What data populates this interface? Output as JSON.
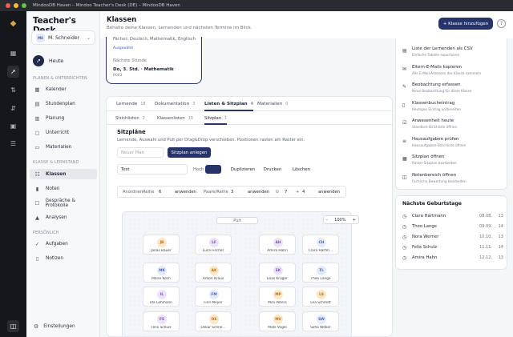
{
  "window": {
    "title": "MindooDB Haven – Mindoo Teacher's Desk (DE) – MindooDB Haven",
    "colors": {
      "close": "#ee5f58",
      "min": "#f6bd3b",
      "max": "#5ec648"
    }
  },
  "rail": {
    "icons": [
      "app-logo-icon",
      "dashboard-icon",
      "rocket-icon",
      "transfer-icon",
      "sort-icon",
      "image-icon",
      "sliders-icon",
      "sidebar-toggle-icon"
    ]
  },
  "sidebar": {
    "logo": "Teacher's Desk",
    "user": {
      "initials": "MS",
      "name": "M. Schneider"
    },
    "home": "Heute",
    "sec1": "PLANEN & UNTERRICHTEN",
    "nav1": [
      {
        "label": "Kalender",
        "icon": "▦"
      },
      {
        "label": "Stundenplan",
        "icon": "▤"
      },
      {
        "label": "Planung",
        "icon": "▥"
      },
      {
        "label": "Unterricht",
        "icon": "▢"
      },
      {
        "label": "Materialien",
        "icon": "▭"
      }
    ],
    "sec2": "KLASSE & LERNSTAND",
    "nav2": [
      {
        "label": "Klassen",
        "icon": "☷"
      },
      {
        "label": "Noten",
        "icon": "▮"
      },
      {
        "label": "Gespräche & Protokolle",
        "icon": "☐"
      },
      {
        "label": "Analysen",
        "icon": "▲"
      }
    ],
    "sec3": "PERSÖNLICH",
    "nav3": [
      {
        "label": "Aufgaben",
        "icon": "✓"
      },
      {
        "label": "Notizen",
        "icon": "▯"
      }
    ],
    "settings": "Einstellungen"
  },
  "header": {
    "title": "Klassen",
    "subtitle": "Behalte deine Klassen, Lernenden und nächsten Termine im Blick.",
    "add_button": "+ Klasse hinzufügen",
    "help": "?"
  },
  "class_card": {
    "subjects": "Fächer: Deutsch, Mathematik, Englisch",
    "status": "Ausgewählt",
    "next_label": "Nächste Stunde",
    "next_value": "Do, 3. Std. · Mathematik",
    "room": "R003"
  },
  "tabs": [
    {
      "label": "Lernende",
      "count": "18"
    },
    {
      "label": "Dokumentation",
      "count": "3"
    },
    {
      "label": "Listen & Sitzplan",
      "count": "4"
    },
    {
      "label": "Materialien",
      "count": "0"
    }
  ],
  "subtabs": [
    {
      "label": "Strichlisten",
      "count": "2"
    },
    {
      "label": "Klassenlisten",
      "count": "10"
    },
    {
      "label": "Sitzplan",
      "count": "1"
    }
  ],
  "seating": {
    "title": "Sitzpläne",
    "desc": "Lernende, Auswahl und Pult per Drag&Drop verschieben. Positionen rasten am Raster ein.",
    "new_plan_placeholder": "Neuer Plan",
    "create_button": "Sitzplan anlegen",
    "plan_name": "Test",
    "orientation_label": "Hoch",
    "duplicate": "Duplizieren",
    "print": "Drucken",
    "delete": "Löschen",
    "arrange_label": "Anordnen",
    "row_label": "Reihe",
    "row_value": "6",
    "apply": "anwenden",
    "pairs_label": "Paare/Reihe",
    "pairs_value": "3",
    "u_label": "U",
    "u_a": "7",
    "plus": "+",
    "u_b": "4",
    "desk": "Pult",
    "zoom_minus": "-",
    "zoom": "100%",
    "zoom_plus": "+",
    "seats": [
      {
        "i": "JB",
        "name": "Jonas Bauer",
        "bg": "#fde7c8",
        "fg": "#b7700f"
      },
      {
        "i": "LF",
        "name": "Luca Fischer",
        "bg": "#ece3fb",
        "fg": "#7a4cc7"
      },
      {
        "i": "AH",
        "name": "Amira Hahn",
        "bg": "#ece3fb",
        "fg": "#7a4cc7"
      },
      {
        "i": "CH",
        "name": "Clara Hartm...",
        "bg": "#e3ebfb",
        "fg": "#4a64c0"
      },
      {
        "i": "MK",
        "name": "Marie Koch",
        "bg": "#e3ebfb",
        "fg": "#4a64c0"
      },
      {
        "i": "AK",
        "name": "Anton Kraus",
        "bg": "#fde7c8",
        "fg": "#b7700f"
      },
      {
        "i": "EK",
        "name": "Elias Krüger",
        "bg": "#ece3fb",
        "fg": "#7a4cc7"
      },
      {
        "i": "TL",
        "name": "Theo Lange",
        "bg": "#e3ebfb",
        "fg": "#4a64c0"
      },
      {
        "i": "IL",
        "name": "Ida Lehmann",
        "bg": "#ece3fb",
        "fg": "#7a4cc7"
      },
      {
        "i": "FM",
        "name": "Finn Meyer",
        "bg": "#e3ebfb",
        "fg": "#4a64c0"
      },
      {
        "i": "MP",
        "name": "Mila Peters",
        "bg": "#fde7c8",
        "fg": "#b7700f"
      },
      {
        "i": "LS",
        "name": "Lea Schmitt",
        "bg": "#fde7c8",
        "fg": "#b7700f"
      },
      {
        "i": "FS",
        "name": "Felix Schulz",
        "bg": "#ece3fb",
        "fg": "#7a4cc7"
      },
      {
        "i": "OS",
        "name": "Oskar Schne...",
        "bg": "#fde7c8",
        "fg": "#b7700f"
      },
      {
        "i": "MV",
        "name": "Mats Vogel",
        "bg": "#fde7c8",
        "fg": "#b7700f"
      },
      {
        "i": "SW",
        "name": "Sofia Weber",
        "bg": "#e3ebfb",
        "fg": "#4a64c0"
      }
    ]
  },
  "quick_actions": [
    {
      "icon": "▤",
      "title": "Liste der Lernenden als CSV",
      "desc": "Einfache Tabelle exportieren"
    },
    {
      "icon": "✉",
      "title": "Eltern-E-Mails kopieren",
      "desc": "Alle E-Mail-Adressen der Klasse sammeln"
    },
    {
      "icon": "✎",
      "title": "Beobachtung erfassen",
      "desc": "Neue Beobachtung für diese Klasse"
    },
    {
      "icon": "▯",
      "title": "Klassenbucheintrag",
      "desc": "Heutigen Eintrag vorbereiten"
    },
    {
      "icon": "☑",
      "title": "Anwesenheit heute",
      "desc": "Standard-Strichliste öffnen"
    },
    {
      "icon": "≡",
      "title": "Hausaufgaben prüfen",
      "desc": "Hausaufgaben-Strichliste öffnen"
    },
    {
      "icon": "▦",
      "title": "Sitzplan öffnen",
      "desc": "Raster-Sitzplan bearbeiten"
    },
    {
      "icon": "◫",
      "title": "Notenbereich öffnen",
      "desc": "Fachliche Bewertung bearbeiten"
    }
  ],
  "birthdays": {
    "title": "Nächste Geburtstage",
    "items": [
      {
        "name": "Clara Hartmann",
        "date": "08.08.",
        "age": "13"
      },
      {
        "name": "Theo Lange",
        "date": "09.09.",
        "age": "14"
      },
      {
        "name": "Nora Werner",
        "date": "10.10.",
        "age": "13"
      },
      {
        "name": "Felix Schulz",
        "date": "11.11.",
        "age": "14"
      },
      {
        "name": "Amira Hahn",
        "date": "12.12.",
        "age": "13"
      }
    ]
  }
}
